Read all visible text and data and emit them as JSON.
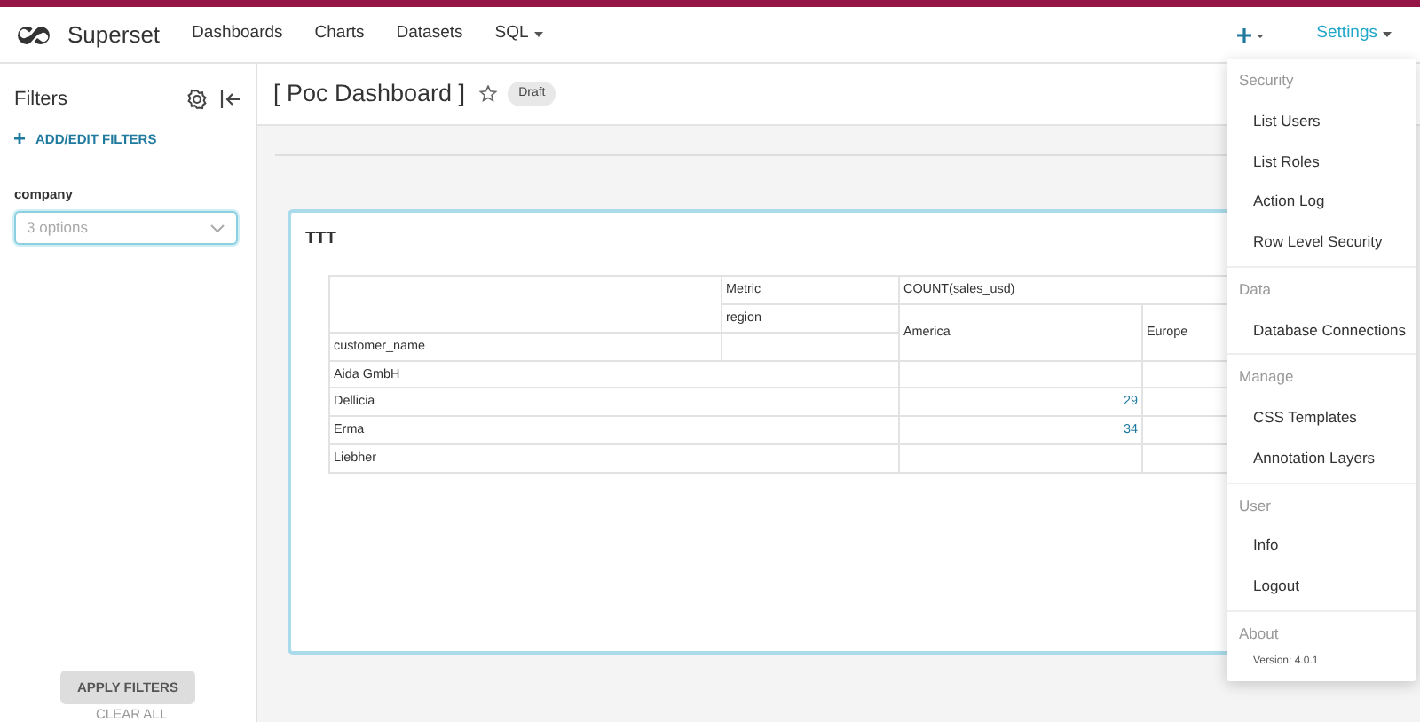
{
  "top_nav": {
    "brand": "Superset",
    "items": [
      {
        "label": "Dashboards",
        "dropdown": false
      },
      {
        "label": "Charts",
        "dropdown": false
      },
      {
        "label": "Datasets",
        "dropdown": false
      },
      {
        "label": "SQL",
        "dropdown": true
      }
    ],
    "settings": {
      "label": "Settings",
      "selected": true
    }
  },
  "filters": {
    "title": "Filters",
    "add_label": "ADD/EDIT FILTERS",
    "filter": {
      "label": "company",
      "placeholder": "3 options"
    },
    "apply": "APPLY FILTERS",
    "clear": "CLEAR ALL"
  },
  "dashboard": {
    "title": "[ Poc Dashboard ]",
    "starred": false,
    "status": "Draft"
  },
  "chart": {
    "title": "TTT",
    "table": {
      "metric_label": "Metric",
      "metric": "COUNT(sales_usd)",
      "column_label": "region",
      "columns": [
        "America",
        "Europe"
      ],
      "row_label": "customer_name",
      "rows": [
        {
          "name": "Aida GmbH",
          "values": [
            {
              "kind": "blank"
            },
            {
              "kind": "blank"
            }
          ]
        },
        {
          "name": "Dellicia",
          "values": [
            {
              "kind": "count",
              "text": "29"
            },
            {
              "kind": "blank"
            }
          ]
        },
        {
          "name": "Erma",
          "values": [
            {
              "kind": "count",
              "text": "34"
            },
            {
              "kind": "blank"
            }
          ]
        },
        {
          "name": "Liebher",
          "values": [
            {
              "kind": "blank"
            },
            {
              "kind": "blank"
            }
          ]
        }
      ]
    }
  },
  "settings_menu": {
    "sections": [
      {
        "heading": "Security",
        "items": [
          "List Users",
          "List Roles",
          "Action Log",
          "Row Level Security"
        ]
      },
      {
        "heading": "Data",
        "items": [
          "Database Connections"
        ]
      },
      {
        "heading": "Manage",
        "items": [
          "CSS Templates",
          "Annotation Layers"
        ]
      },
      {
        "heading": "User",
        "items": [
          "Info",
          "Logout"
        ]
      },
      {
        "heading": "About",
        "version": "Version: 4.0.1"
      }
    ]
  }
}
